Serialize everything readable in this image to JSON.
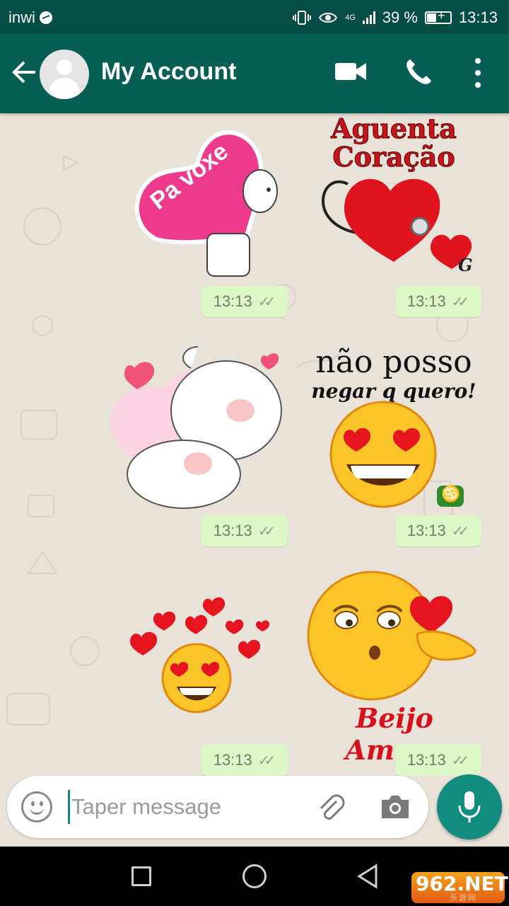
{
  "status_bar": {
    "carrier": "inwi",
    "network": "4G",
    "battery": "39 %",
    "time": "13:13"
  },
  "header": {
    "title": "My Account"
  },
  "stickers": [
    {
      "text": "Pa voxe",
      "time": "13:13"
    },
    {
      "text": "Aguenta Coração",
      "badge": "G",
      "time": "13:13"
    },
    {
      "text": "",
      "time": "13:13"
    },
    {
      "line1": "não posso",
      "line2": "negar q quero!",
      "badge": "♋",
      "time": "13:13"
    },
    {
      "text": "",
      "time": "13:13"
    },
    {
      "text": "Beijo Amore",
      "time": "13:13"
    }
  ],
  "composer": {
    "placeholder": "Taper message"
  },
  "watermark": {
    "big": "962.NET",
    "small": "乐游网"
  },
  "colors": {
    "header": "#075e54",
    "status": "#054d44",
    "bubble": "#dcf8c6",
    "accent": "#128c7e"
  }
}
